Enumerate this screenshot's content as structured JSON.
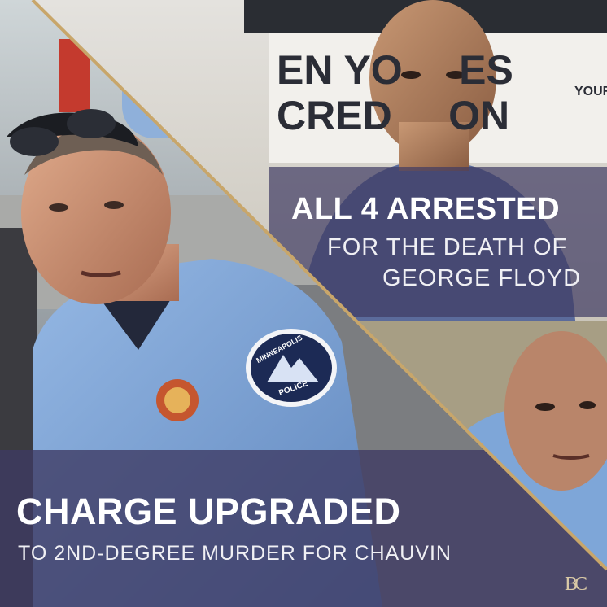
{
  "image": {
    "top_right": {
      "headline": "ALL 4 ARRESTED",
      "subline_1": "FOR THE DEATH OF",
      "subline_2": "GEORGE FLOYD"
    },
    "bottom_left": {
      "headline": "CHARGE UPGRADED",
      "subline": "TO 2ND-DEGREE MURDER FOR CHAUVIN"
    },
    "sign_text": {
      "line_1": "EN YO     ES",
      "line_2": "CRED     ON",
      "small": "YOUR"
    },
    "patch_text": {
      "top": "MINNEAPOLIS",
      "bottom": "POLICE"
    },
    "logo": "BC",
    "colors": {
      "gold_divider": "#c8a66a",
      "overlay_purple": "#3e3a63",
      "uniform_blue": "#7ea6d8",
      "skin": "#c98f72"
    }
  }
}
